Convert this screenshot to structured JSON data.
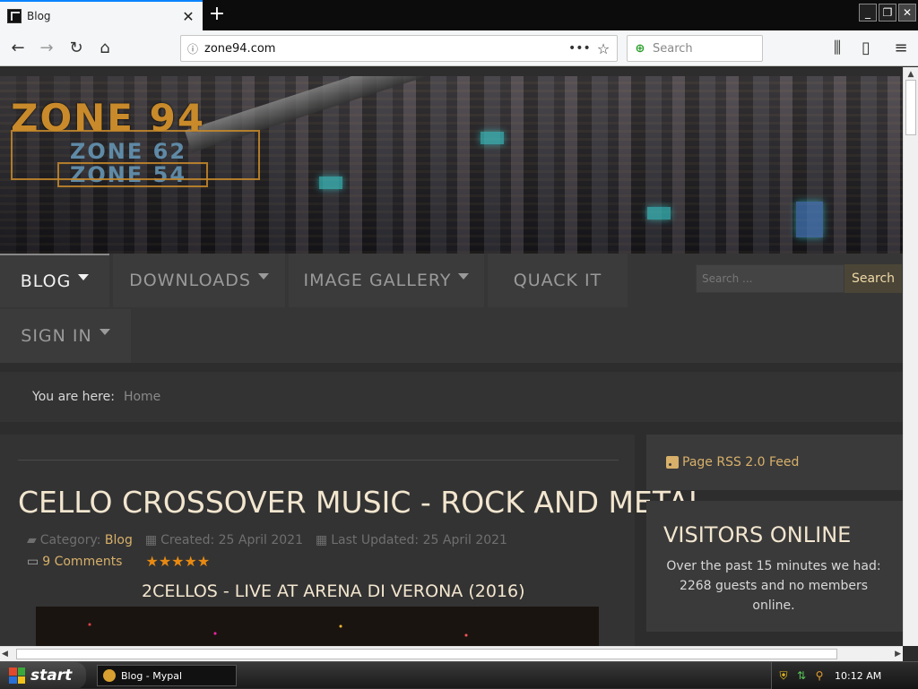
{
  "browser": {
    "tab_title": "Blog",
    "url": "zone94.com",
    "search_placeholder": "Search"
  },
  "site": {
    "logo_main": "ZONE 94",
    "logo_sub1": "ZONE 62",
    "logo_sub2": "ZONE 54",
    "menu": {
      "blog": "BLOG",
      "downloads": "DOWNLOADS",
      "gallery": "IMAGE GALLERY",
      "quack": "QUACK IT",
      "signin": "SIGN IN"
    },
    "search_placeholder": "Search ...",
    "search_button": "Search",
    "breadcrumb_label": "You are here:",
    "breadcrumb_home": "Home"
  },
  "article": {
    "title": "CELLO CROSSOVER MUSIC - ROCK AND METAL",
    "category_label": "Category:",
    "category": "Blog",
    "created": "Created: 25 April 2021",
    "updated": "Last Updated: 25 April 2021",
    "comments": "9 Comments",
    "rating_stars": "★★★★★",
    "subheading": "2CELLOS - LIVE AT ARENA DI VERONA (2016)"
  },
  "sidebar": {
    "rss": "Page RSS 2.0 Feed",
    "visitors_title": "VISITORS ONLINE",
    "visitors_text": "Over the past 15 minutes we had: 2268 guests and no members online."
  },
  "taskbar": {
    "start": "start",
    "task": "Blog - Mypal",
    "clock": "10:12 AM"
  },
  "colors": {
    "accent_gold": "#d8b06a",
    "title_cream": "#f3e6cf",
    "star_orange": "#e88a12",
    "page_bg": "#2d2d2d"
  }
}
